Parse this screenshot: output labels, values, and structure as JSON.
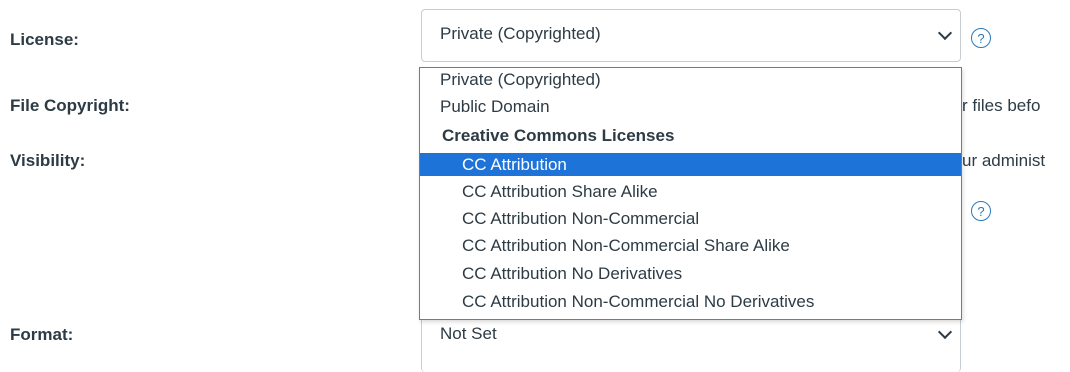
{
  "license": {
    "label": "License:",
    "selected": "Private (Copyrighted)",
    "help_glyph": "?"
  },
  "file_copyright": {
    "label": "File Copyright:",
    "partial_text": "r files befo"
  },
  "visibility": {
    "label": "Visibility:",
    "partial_text": "ur administ",
    "help_glyph": "?"
  },
  "format": {
    "label": "Format:",
    "selected": "Not Set"
  },
  "dropdown": {
    "options": [
      "Private (Copyrighted)",
      "Public Domain"
    ],
    "group_label": "Creative Commons Licenses",
    "cc_options": [
      "CC Attribution",
      "CC Attribution Share Alike",
      "CC Attribution Non-Commercial",
      "CC Attribution Non-Commercial Share Alike",
      "CC Attribution No Derivatives",
      "CC Attribution Non-Commercial No Derivatives"
    ],
    "highlighted": "CC Attribution"
  },
  "colors": {
    "highlight": "#1e73d9",
    "help_icon": "#2b7abc",
    "text": "#2d3b45",
    "border": "#c7cdd1"
  }
}
